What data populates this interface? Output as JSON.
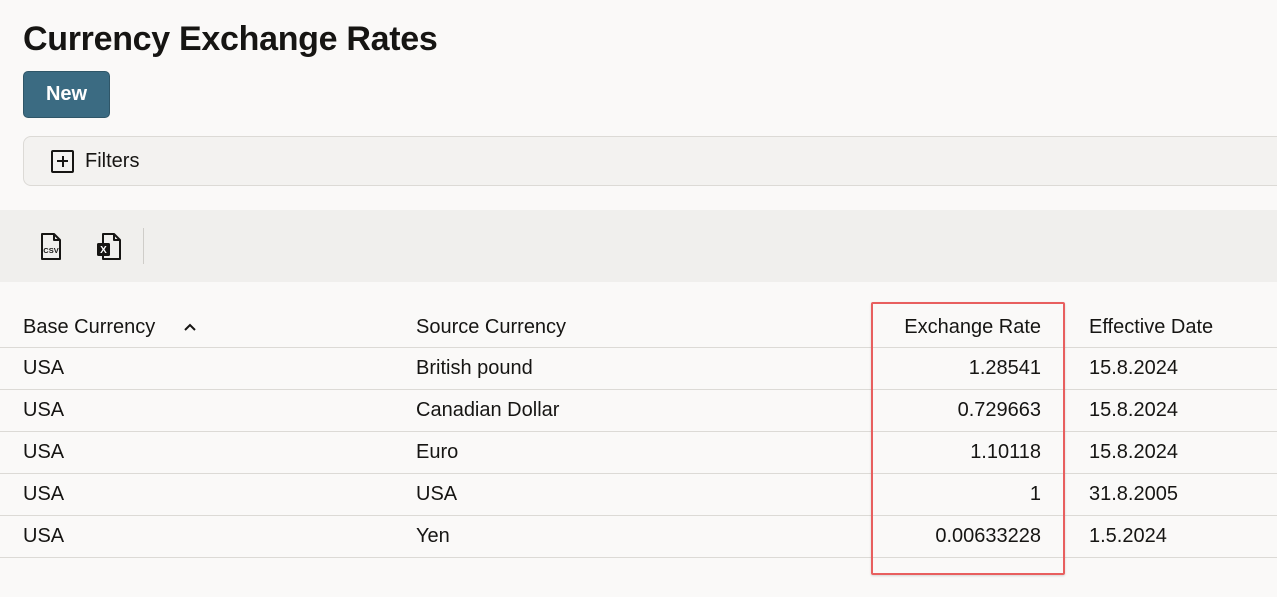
{
  "page": {
    "title": "Currency Exchange Rates",
    "new_button_label": "New",
    "filters_label": "Filters"
  },
  "toolbar": {
    "icons": [
      "csv-export-icon",
      "excel-export-icon"
    ],
    "csv_label": "CSV",
    "excel_label": "X"
  },
  "table": {
    "columns": [
      "Base Currency",
      "Source Currency",
      "Exchange Rate",
      "Effective Date"
    ],
    "sort": {
      "column": "Base Currency",
      "direction": "ascending"
    },
    "rows": [
      {
        "base": "USA",
        "source": "British pound",
        "rate": "1.28541",
        "date": "15.8.2024"
      },
      {
        "base": "USA",
        "source": "Canadian Dollar",
        "rate": "0.729663",
        "date": "15.8.2024"
      },
      {
        "base": "USA",
        "source": "Euro",
        "rate": "1.10118",
        "date": "15.8.2024"
      },
      {
        "base": "USA",
        "source": "USA",
        "rate": "1",
        "date": "31.8.2005"
      },
      {
        "base": "USA",
        "source": "Yen",
        "rate": "0.00633228",
        "date": "1.5.2024"
      }
    ]
  },
  "colors": {
    "primary_button": "#3b6b82",
    "highlight_border": "#e85f5f",
    "background": "#faf9f8"
  }
}
